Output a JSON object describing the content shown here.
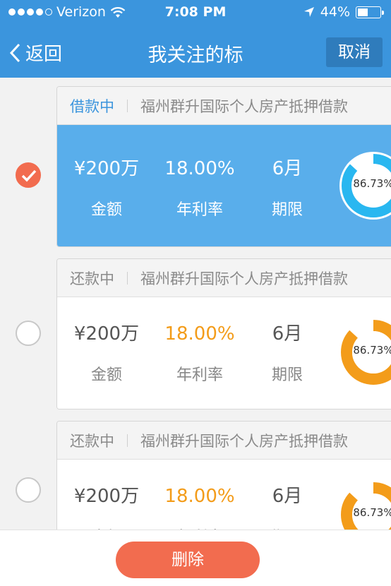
{
  "status_bar": {
    "carrier": "Verizon",
    "time": "7:08 PM",
    "battery": "44%"
  },
  "nav": {
    "back_label": "返回",
    "title": "我关注的标",
    "cancel_label": "取消"
  },
  "labels": {
    "amount": "金额",
    "rate": "年利率",
    "term": "期限"
  },
  "loans": [
    {
      "status": "借款中",
      "name": "福州群升国际个人房产抵押借款",
      "amount": "¥200万",
      "rate": "18.00%",
      "term": "6月",
      "progress": "86.73%",
      "progress_value": 0.8673,
      "selected": true
    },
    {
      "status": "还款中",
      "name": "福州群升国际个人房产抵押借款",
      "amount": "¥200万",
      "rate": "18.00%",
      "term": "6月",
      "progress": "86.73%",
      "progress_value": 0.8673,
      "selected": false
    },
    {
      "status": "还款中",
      "name": "福州群升国际个人房产抵押借款",
      "amount": "¥200万",
      "rate": "18.00%",
      "term": "6月",
      "progress": "86.73%",
      "progress_value": 0.8673,
      "selected": false
    }
  ],
  "bottom": {
    "delete_label": "删除"
  },
  "colors": {
    "primary": "#3b95dd",
    "selected_card": "#59aeeb",
    "accent": "#f26c4f",
    "rate_orange": "#f39c1a"
  },
  "icons": {
    "signal": "signal-dots-icon",
    "wifi": "wifi-icon",
    "location": "location-arrow-icon",
    "battery": "battery-icon",
    "back": "chevron-left-icon",
    "check": "checkmark-icon"
  }
}
